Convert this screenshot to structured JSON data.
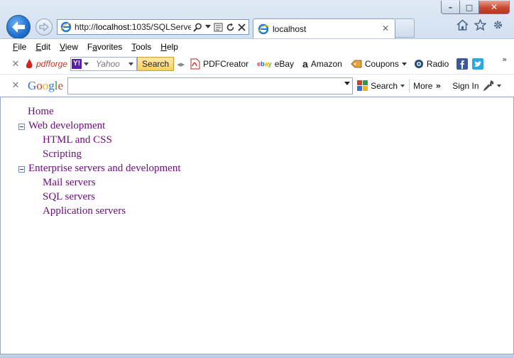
{
  "window": {
    "minimize_glyph": "–",
    "maximize_glyph": "□",
    "close_glyph": "✕"
  },
  "nav": {
    "back_icon": "back-arrow-icon",
    "forward_icon": "forward-arrow-icon",
    "address_prefix": "http://",
    "address_host": "localhost",
    "address_rest": ":1035/SQLServe",
    "tab_title": "localhost",
    "tab_close": "✕"
  },
  "menu": {
    "items": [
      {
        "label": "File",
        "key": "F"
      },
      {
        "label": "Edit",
        "key": "E"
      },
      {
        "label": "View",
        "key": "V"
      },
      {
        "label": "Favorites",
        "key": "a"
      },
      {
        "label": "Tools",
        "key": "T"
      },
      {
        "label": "Help",
        "key": "H"
      }
    ]
  },
  "toolbar1": {
    "pdfforge": "pdfforge",
    "yahoo_logo": "Y!",
    "yahoo_placeholder": "Yahoo",
    "search_label": "Search",
    "pdfcreator": "PDFCreator",
    "ebay": "eBay",
    "amazon": "Amazon",
    "coupons": "Coupons",
    "radio": "Radio"
  },
  "toolbar2": {
    "google_label": "Google",
    "search_label": "Search",
    "more_label": "More",
    "signin_label": "Sign In"
  },
  "tree": {
    "home": "Home",
    "web_dev": "Web development",
    "html_css": "HTML and CSS",
    "scripting": "Scripting",
    "enterprise": "Enterprise servers and development",
    "mail": "Mail servers",
    "sql": "SQL servers",
    "app": "Application servers"
  },
  "colors": {
    "link_visited": "#6b0b7d",
    "chrome_blue": "#cddcee"
  }
}
